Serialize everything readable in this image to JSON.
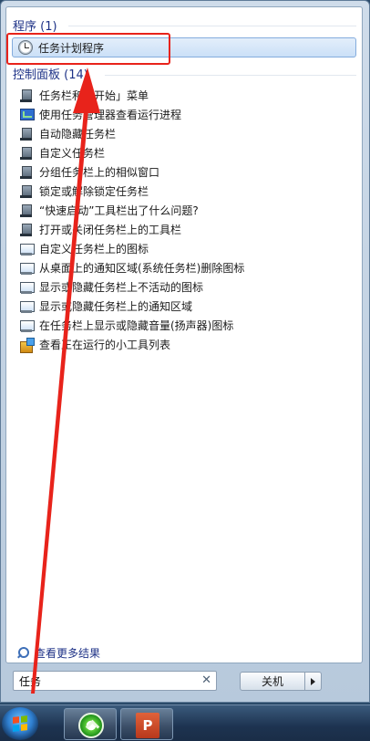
{
  "programs": {
    "header": "程序 (1)",
    "item_label": "任务计划程序",
    "item_icon": "clock-icon"
  },
  "control_panel": {
    "header": "控制面板 (14)",
    "items": [
      {
        "label": "任务栏和「开始」菜单",
        "icon": "taskbar-icon"
      },
      {
        "label": "使用任务管理器查看运行进程",
        "icon": "task-manager-icon"
      },
      {
        "label": "自动隐藏任务栏",
        "icon": "taskbar-icon"
      },
      {
        "label": "自定义任务栏",
        "icon": "taskbar-icon"
      },
      {
        "label": "分组任务栏上的相似窗口",
        "icon": "taskbar-icon"
      },
      {
        "label": "锁定或解除锁定任务栏",
        "icon": "taskbar-icon"
      },
      {
        "label": "“快速启动”工具栏出了什么问题?",
        "icon": "taskbar-icon"
      },
      {
        "label": "打开或关闭任务栏上的工具栏",
        "icon": "taskbar-icon"
      },
      {
        "label": "自定义任务栏上的图标",
        "icon": "monitor-icon"
      },
      {
        "label": "从桌面上的通知区域(系统任务栏)删除图标",
        "icon": "monitor-icon"
      },
      {
        "label": "显示或隐藏任务栏上不活动的图标",
        "icon": "monitor-icon"
      },
      {
        "label": "显示或隐藏任务栏上的通知区域",
        "icon": "monitor-icon"
      },
      {
        "label": "在任务栏上显示或隐藏音量(扬声器)图标",
        "icon": "monitor-icon"
      },
      {
        "label": "查看正在运行的小工具列表",
        "icon": "gadget-icon"
      }
    ]
  },
  "more_results": {
    "label": "查看更多结果",
    "icon": "search-icon"
  },
  "search": {
    "value": "任务",
    "clear_icon": "clear-icon"
  },
  "shutdown": {
    "label": "关机",
    "arrow_icon": "arrow-right-icon"
  },
  "taskbar": {
    "buttons": [
      {
        "name": "internet-explorer",
        "icon": "ie-icon"
      },
      {
        "name": "powerpoint",
        "icon": "powerpoint-icon"
      }
    ]
  },
  "annotation": {
    "color": "#e8231b"
  }
}
